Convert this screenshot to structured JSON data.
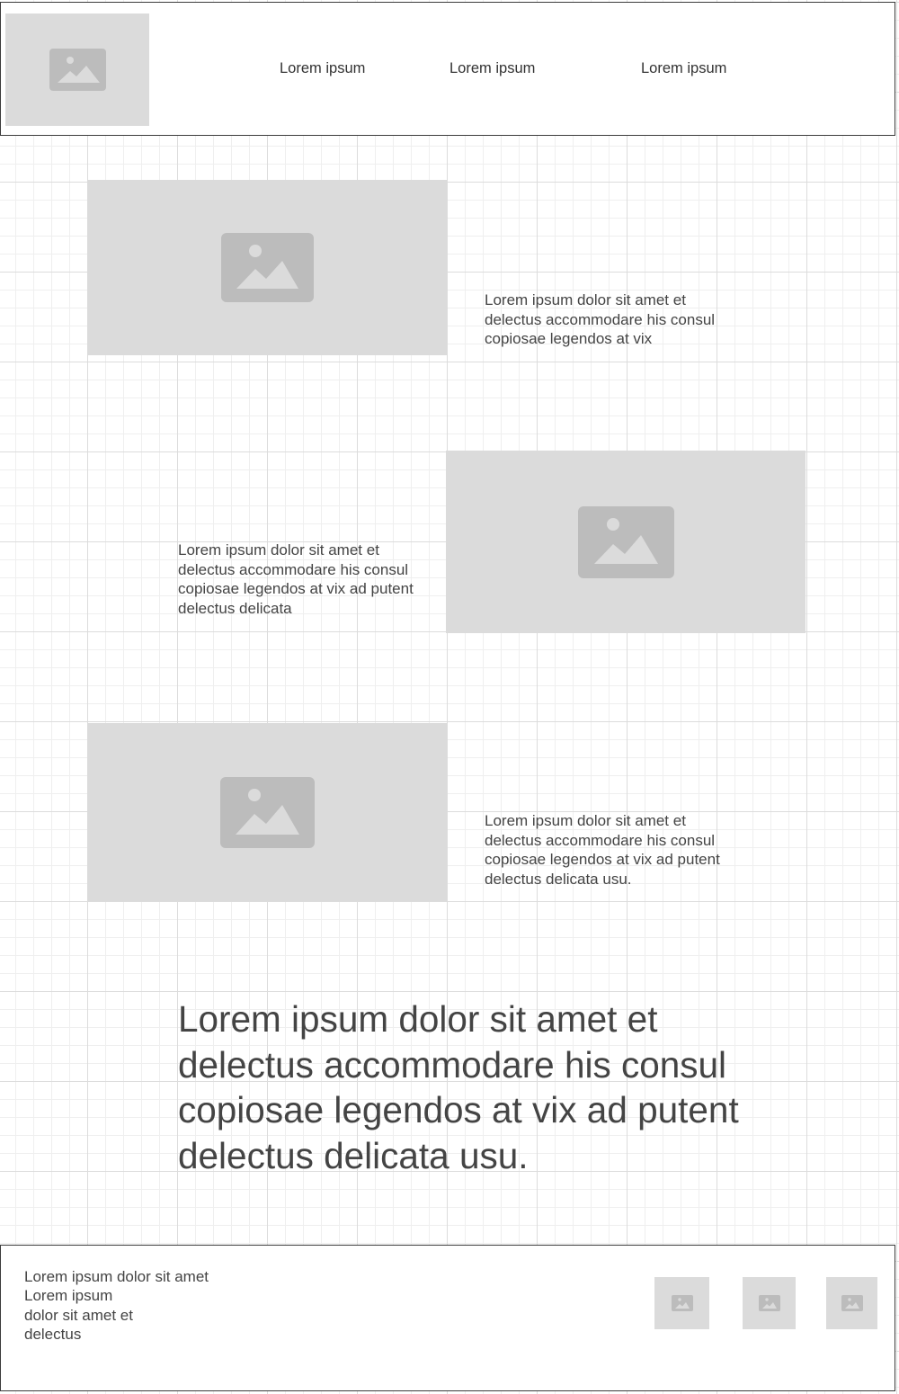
{
  "header": {
    "logo_icon": "image-placeholder-icon",
    "nav": [
      "Lorem ipsum",
      "Lorem ipsum",
      "Lorem ipsum"
    ]
  },
  "features": [
    {
      "image_icon": "image-placeholder-icon",
      "text": "Lorem ipsum dolor sit amet et delectus accommodare his consul copiosae legendos at vix"
    },
    {
      "image_icon": "image-placeholder-icon",
      "text": "Lorem ipsum dolor sit amet et delectus accommodare his consul copiosae legendos at vix ad putent delectus delicata"
    },
    {
      "image_icon": "image-placeholder-icon",
      "text": "Lorem ipsum dolor sit amet et delectus accommodare his consul copiosae legendos at vix ad putent delectus delicata usu."
    }
  ],
  "headline": "Lorem ipsum dolor sit amet et delectus accommodare his consul copiosae legendos at vix ad putent delectus delicata usu.",
  "footer": {
    "lines": [
      "Lorem ipsum dolor sit amet",
      "Lorem ipsum",
      "dolor sit amet et",
      "delectus"
    ],
    "social_icons": [
      "image-placeholder-icon",
      "image-placeholder-icon",
      "image-placeholder-icon"
    ]
  },
  "colors": {
    "placeholder_bg": "#dbdbdb",
    "placeholder_icon": "#bcbcbc",
    "text": "#444444",
    "border": "#3c3c3c",
    "grid": "#dcdcdc"
  }
}
